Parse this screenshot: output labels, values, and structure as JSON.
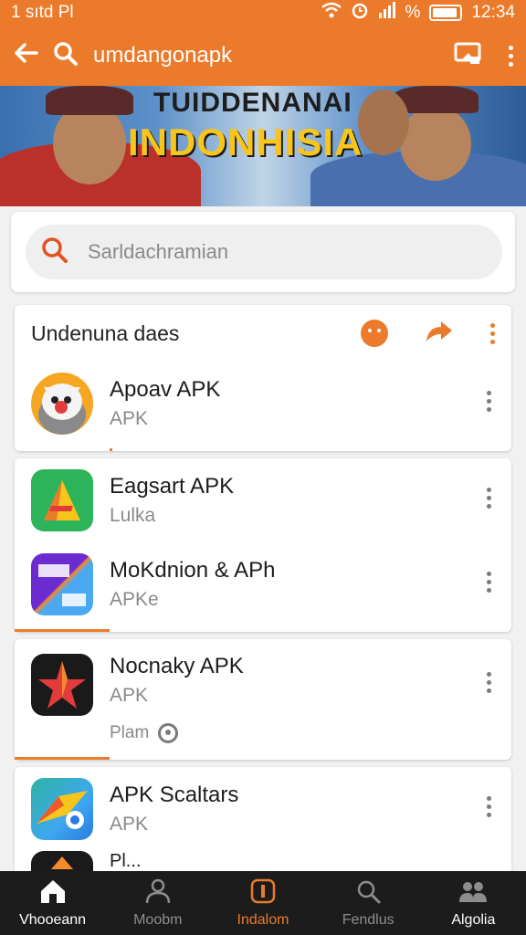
{
  "status_bar": {
    "left_text": "1 sıtd Pl",
    "percent": "%",
    "time": "12:34"
  },
  "app_bar": {
    "query": "umdangonapk"
  },
  "banner": {
    "line1": "TUIDDENANAI",
    "line2": "INDONHISIA"
  },
  "search": {
    "placeholder": "Sarldachramian"
  },
  "section": {
    "title": "Undenuna daes"
  },
  "apps": [
    {
      "name": "Apoav APK",
      "sub": "APK",
      "icon": "mascot-icon"
    },
    {
      "name": "Eagsart APK",
      "sub": "Lulka",
      "icon": "triangle-app-icon"
    },
    {
      "name": "MoKdnion & APh",
      "sub": "APKe",
      "icon": "gradient-app-icon"
    },
    {
      "name": "Nocnaky APK",
      "sub": "APK",
      "extra": "Plam",
      "icon": "star-app-icon"
    },
    {
      "name": "APK Scaltars",
      "sub": "APK",
      "icon": "maps-app-icon"
    },
    {
      "name": "Pl...",
      "sub": "",
      "icon": "partial-app-icon"
    }
  ],
  "bottom_nav": [
    {
      "label": "Vhooeann",
      "icon": "home-icon"
    },
    {
      "label": "Moobm",
      "icon": "people-outline-icon"
    },
    {
      "label": "Indalom",
      "icon": "info-icon"
    },
    {
      "label": "Fendlus",
      "icon": "search-icon"
    },
    {
      "label": "Algolia",
      "icon": "group-icon"
    }
  ],
  "colors": {
    "accent": "#ec7a2b",
    "nav_bg": "#1c1c1c",
    "card_bg": "#ffffff"
  }
}
